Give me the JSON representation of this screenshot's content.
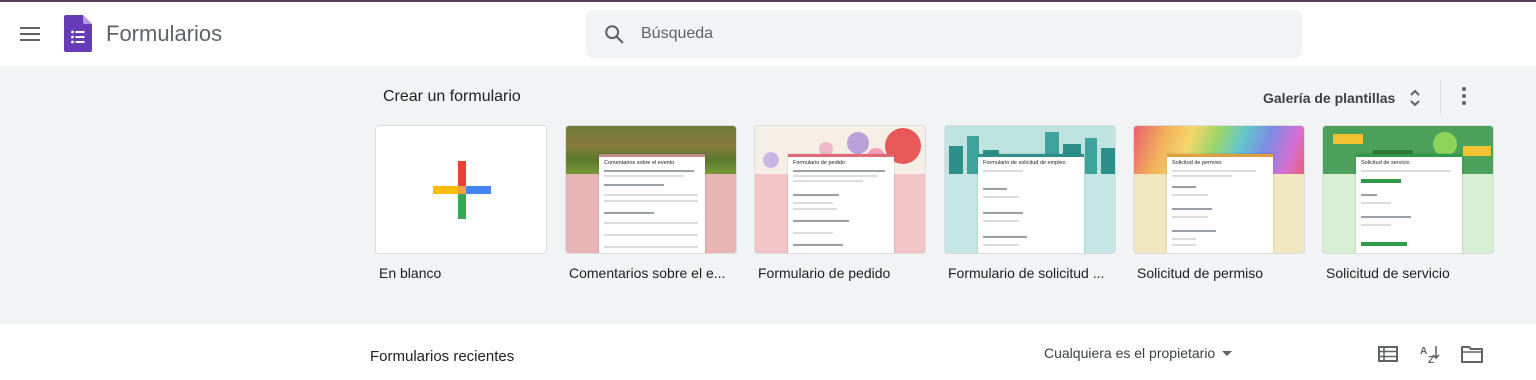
{
  "header": {
    "app_title": "Formularios",
    "search": {
      "placeholder": "Búsqueda",
      "value": ""
    }
  },
  "gallery": {
    "title": "Crear un formulario",
    "template_gallery_label": "Galería de plantillas",
    "templates": [
      {
        "label": "En blanco",
        "doc_title": ""
      },
      {
        "label": "Comentarios sobre el e...",
        "doc_title": "Comentarios sobre el evento"
      },
      {
        "label": "Formulario de pedido",
        "doc_title": "Formulario de pedido"
      },
      {
        "label": "Formulario de solicitud ...",
        "doc_title": "Formulario de solicitud de empleo"
      },
      {
        "label": "Solicitud de permiso",
        "doc_title": "Solicitud de permiso"
      },
      {
        "label": "Solicitud de servicio",
        "doc_title": "Solicitud de servicio"
      }
    ]
  },
  "recent": {
    "title": "Formularios recientes",
    "owner_filter": "Cualquiera es el propietario"
  },
  "colors": {
    "brand": "#673ab7",
    "gallery_bg": "#f1f3f4",
    "event_accent": "#e8b4b4",
    "order_accent": "#f2c6c6",
    "job_accent": "#c4e6e4",
    "permit_accent": "#f0e6bf",
    "service_accent": "#d7efd3"
  },
  "icons": [
    "menu-icon",
    "forms-logo-icon",
    "search-icon",
    "unfold-icon",
    "more-vert-icon",
    "plus-icon",
    "list-view-icon",
    "sort-az-icon",
    "folder-icon",
    "dropdown-arrow-icon"
  ]
}
